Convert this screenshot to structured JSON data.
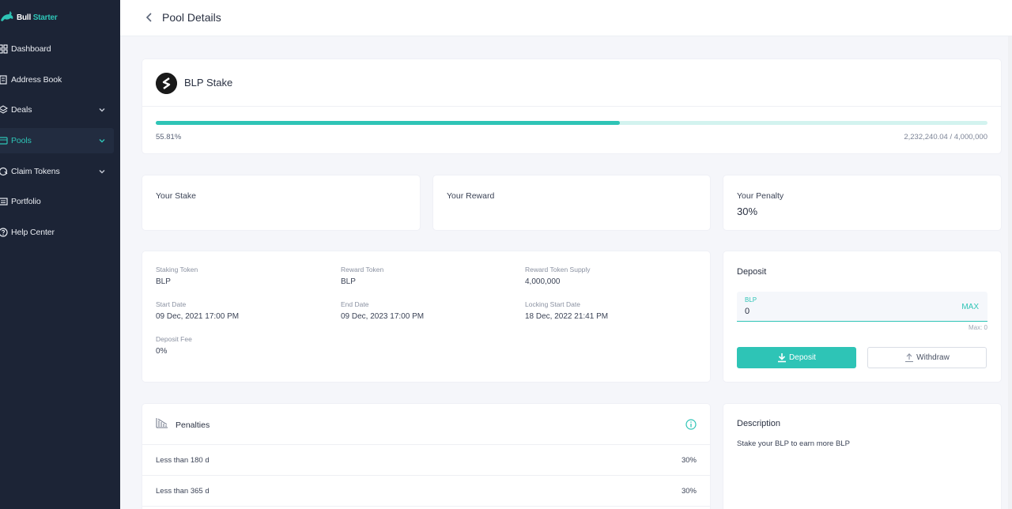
{
  "brand": {
    "part1": "Bull",
    "part2": "Starter"
  },
  "sidebar": {
    "items": [
      {
        "label": "Dashboard",
        "icon": "dashboard-icon",
        "chevron": false,
        "active": false
      },
      {
        "label": "Address Book",
        "icon": "address-book-icon",
        "chevron": false,
        "active": false
      },
      {
        "label": "Deals",
        "icon": "deals-icon",
        "chevron": true,
        "active": false
      },
      {
        "label": "Pools",
        "icon": "pools-icon",
        "chevron": true,
        "active": true
      },
      {
        "label": "Claim Tokens",
        "icon": "claim-tokens-icon",
        "chevron": true,
        "active": false
      },
      {
        "label": "Portfolio",
        "icon": "portfolio-icon",
        "chevron": false,
        "active": false
      },
      {
        "label": "Help Center",
        "icon": "help-icon",
        "chevron": false,
        "active": false
      }
    ]
  },
  "header": {
    "title": "Pool Details"
  },
  "pool": {
    "name": "BLP Stake",
    "progress_fraction": 0.5581,
    "progress_pct": "55.81%",
    "progress_amount": "2,232,240.04 / 4,000,000"
  },
  "stats": {
    "stake_label": "Your Stake",
    "stake_value": "",
    "reward_label": "Your Reward",
    "reward_value": "",
    "penalty_label": "Your Penalty",
    "penalty_value": "30%"
  },
  "info": {
    "staking_token_label": "Staking Token",
    "staking_token": "BLP",
    "reward_token_label": "Reward Token",
    "reward_token": "BLP",
    "supply_label": "Reward Token Supply",
    "supply": "4,000,000",
    "start_label": "Start Date",
    "start": "09 Dec, 2021 17:00 PM",
    "end_label": "End Date",
    "end": "09 Dec, 2023 17:00 PM",
    "lock_label": "Locking Start Date",
    "lock": "18 Dec, 2022 21:41 PM",
    "fee_label": "Deposit Fee",
    "fee": "0%"
  },
  "deposit": {
    "title": "Deposit",
    "field_label": "BLP",
    "field_value": "0",
    "max_label": "MAX",
    "max_note": "Max: 0",
    "deposit_btn": "Deposit",
    "withdraw_btn": "Withdraw"
  },
  "penalties": {
    "title": "Penalties",
    "rows": [
      {
        "label": "Less than 180 d",
        "value": "30%"
      },
      {
        "label": "Less than 365 d",
        "value": "30%"
      }
    ]
  },
  "description": {
    "title": "Description",
    "text": "Stake your BLP to earn more BLP"
  },
  "colors": {
    "accent": "#2ec4b6",
    "sidebar": "#1c2436"
  }
}
